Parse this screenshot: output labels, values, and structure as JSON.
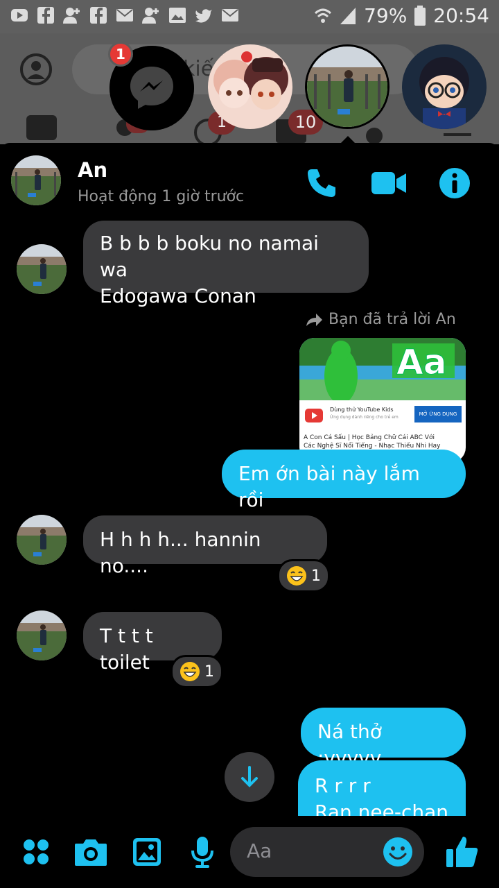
{
  "status_bar": {
    "battery": "79%",
    "time": "20:54"
  },
  "background": {
    "search_text": "kiế         Fa      k",
    "badges": [
      "1",
      "10"
    ]
  },
  "chat_head": {
    "badge": "1"
  },
  "header": {
    "name": "An",
    "status": "Hoạt động 1 giờ trước"
  },
  "messages": {
    "m1_line1": "B b b b boku no namai wa",
    "m1_line2": "Edogawa Conan",
    "reply_note": "Bạn đã trả lời An",
    "card": {
      "yt_title": "Dùng thử YouTube Kids",
      "yt_sub": "Ứng dụng dành riêng cho trẻ em",
      "yt_button": "MỞ ỨNG DỤNG",
      "video_title_1": "A Con Cá Sấu | Học Bảng Chữ Cái ABC Với",
      "video_title_2": "Các Nghệ Sĩ Nổi Tiếng - Nhạc Thiếu Nhi Hay"
    },
    "m2": "Em ớn bài này lắm rồi",
    "m3": "H h h h... hannin no....",
    "m3_react_count": "1",
    "m4": "T t t t toilet",
    "m4_react_count": "1",
    "m5": "Ná thở :vvvvv",
    "m6_line1": "R r r r",
    "m6_line2": "Ran nee-chan"
  },
  "composer": {
    "placeholder": "Aa"
  },
  "colors": {
    "accent": "#1ec1f0",
    "bubble_in": "#3a3a3c",
    "badge": "#e53935"
  }
}
